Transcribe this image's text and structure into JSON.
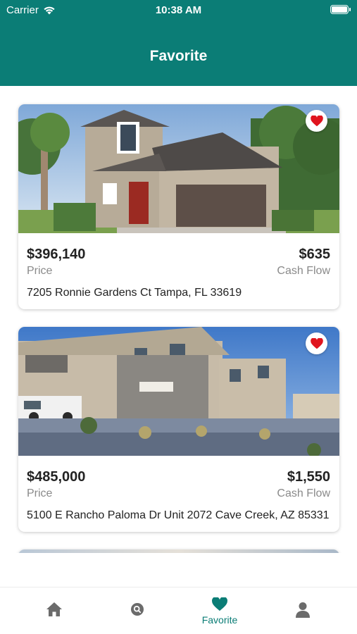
{
  "status_bar": {
    "carrier": "Carrier",
    "time": "10:38 AM"
  },
  "header": {
    "title": "Favorite"
  },
  "colors": {
    "accent": "#0b7d76",
    "heart": "#e0141e",
    "inactive_icon": "#6b6b6b"
  },
  "listings": [
    {
      "price": "$396,140",
      "price_label": "Price",
      "cash_flow": "$635",
      "cash_flow_label": "Cash Flow",
      "address": "7205 Ronnie Gardens Ct Tampa, FL 33619",
      "favorited": true
    },
    {
      "price": "$485,000",
      "price_label": "Price",
      "cash_flow": "$1,550",
      "cash_flow_label": "Cash Flow",
      "address": "5100 E Rancho Paloma Dr Unit 2072 Cave Creek, AZ 85331",
      "favorited": true
    }
  ],
  "tab_bar": {
    "tabs": [
      {
        "icon": "home-icon",
        "label": ""
      },
      {
        "icon": "search-icon",
        "label": ""
      },
      {
        "icon": "heart-icon",
        "label": "Favorite",
        "active": true
      },
      {
        "icon": "profile-icon",
        "label": ""
      }
    ]
  }
}
